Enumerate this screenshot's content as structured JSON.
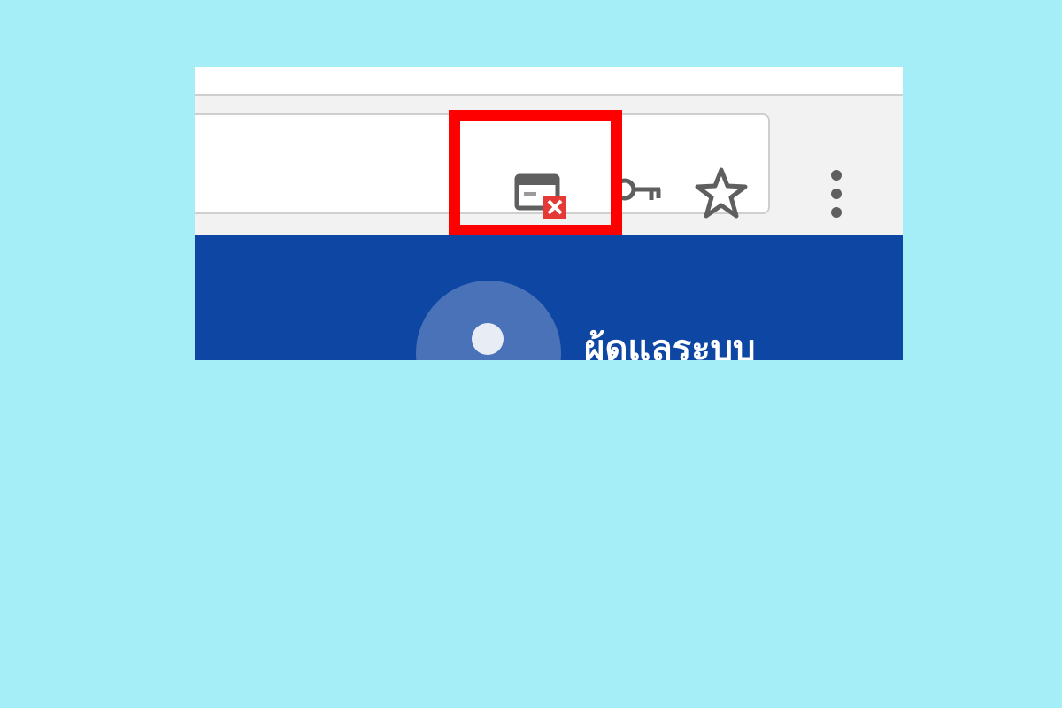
{
  "browser": {
    "icons": {
      "popup_blocked": "popup-blocked-icon",
      "password_key": "key-icon",
      "bookmark_star": "star-icon",
      "menu": "vertical-ellipsis-icon"
    },
    "highlight_color": "#ff0000"
  },
  "page": {
    "header_color": "#0d46a3",
    "user_label": "ผู้ดูแลระบบ"
  },
  "canvas": {
    "background": "#a6eef7"
  }
}
